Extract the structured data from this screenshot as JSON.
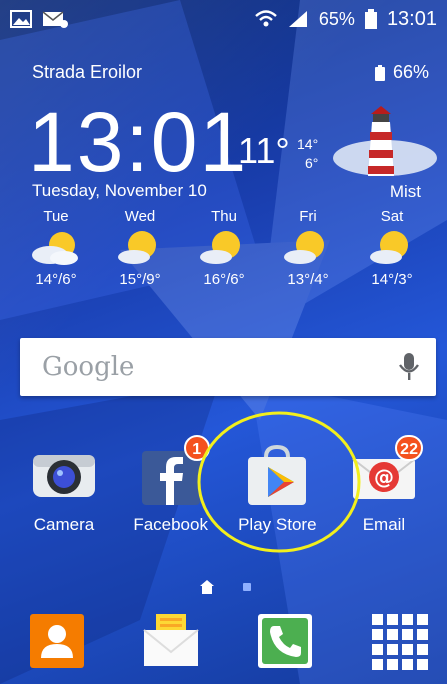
{
  "status_bar": {
    "battery_percent": "65%",
    "time": "13:01",
    "icons": [
      "image-icon",
      "email-icon",
      "wifi-icon",
      "signal-icon",
      "battery-icon"
    ]
  },
  "weather": {
    "location": "Strada Eroilor",
    "battery_widget": "66%",
    "clock": "13:01",
    "temp_now": "11°",
    "temp_high": "14°",
    "temp_low": "6°",
    "date": "Tuesday, November 10",
    "condition": "Mist",
    "forecast": [
      {
        "day": "Tue",
        "range": "14°/6°"
      },
      {
        "day": "Wed",
        "range": "15°/9°"
      },
      {
        "day": "Thu",
        "range": "16°/6°"
      },
      {
        "day": "Fri",
        "range": "13°/4°"
      },
      {
        "day": "Sat",
        "range": "14°/3°"
      }
    ]
  },
  "search": {
    "logo": "Google",
    "mic": "mic-icon"
  },
  "apps": [
    {
      "label": "Camera",
      "badge": ""
    },
    {
      "label": "Facebook",
      "badge": "1"
    },
    {
      "label": "Play Store",
      "badge": ""
    },
    {
      "label": "Email",
      "badge": "22"
    }
  ],
  "dock": [
    "contacts-icon",
    "messages-icon",
    "phone-icon",
    "apps-grid-icon"
  ],
  "colors": {
    "highlight": "#f2ef1c",
    "badge": "#f4511e",
    "accent_green": "#4caf50"
  }
}
